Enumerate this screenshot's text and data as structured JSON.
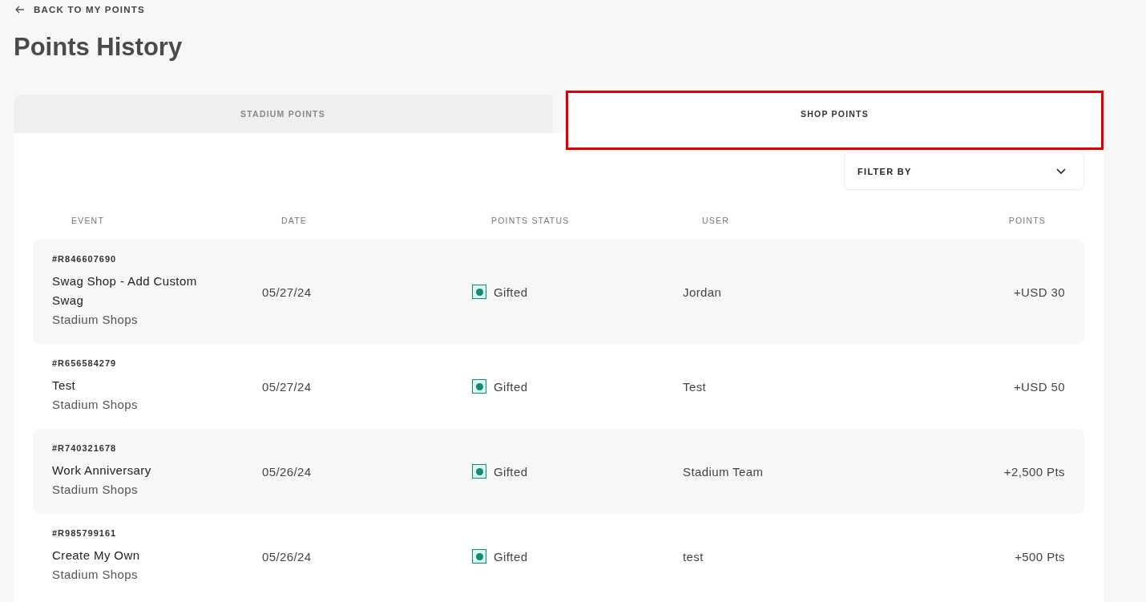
{
  "back_link": "BACK TO MY POINTS",
  "title": "Points History",
  "tabs": [
    {
      "label": "STADIUM POINTS",
      "selected": false
    },
    {
      "label": "SHOP POINTS",
      "selected": true
    }
  ],
  "filter": {
    "label": "FILTER BY"
  },
  "table": {
    "columns": [
      "EVENT",
      "DATE",
      "POINTS STATUS",
      "USER",
      "POINTS"
    ],
    "rows": [
      {
        "id": "#R846607690",
        "event": "Swag Shop - Add Custom Swag",
        "source": "Stadium Shops",
        "date": "05/27/24",
        "status": "Gifted",
        "user": "Jordan",
        "points": "+USD 30"
      },
      {
        "id": "#R656584279",
        "event": "Test",
        "source": "Stadium Shops",
        "date": "05/27/24",
        "status": "Gifted",
        "user": "Test",
        "points": "+USD 50"
      },
      {
        "id": "#R740321678",
        "event": "Work Anniversary",
        "source": "Stadium Shops",
        "date": "05/26/24",
        "status": "Gifted",
        "user": "Stadium Team",
        "points": "+2,500 Pts"
      },
      {
        "id": "#R985799161",
        "event": "Create My Own",
        "source": "Stadium Shops",
        "date": "05/26/24",
        "status": "Gifted",
        "user": "test",
        "points": "+500 Pts"
      }
    ]
  }
}
